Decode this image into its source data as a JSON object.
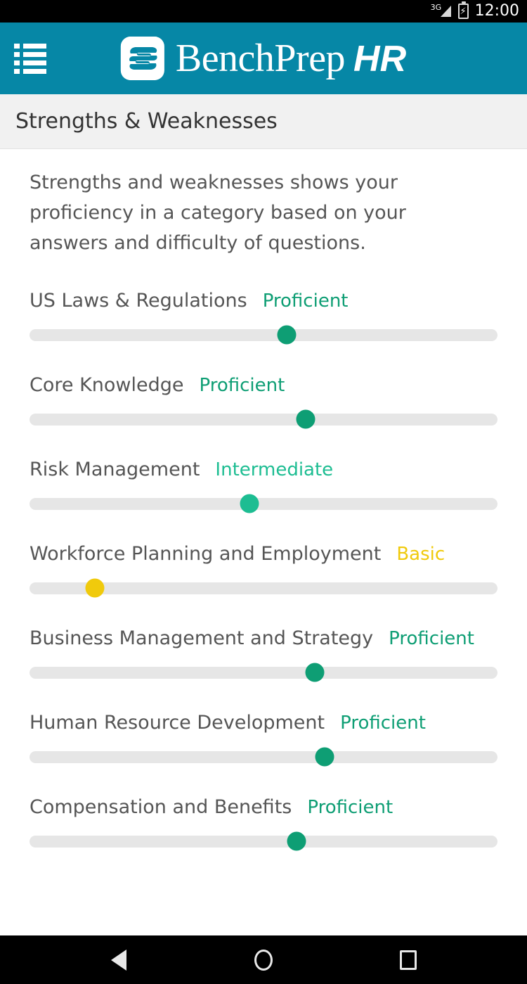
{
  "status_bar": {
    "network_label": "3G",
    "signal_icon": "signal-bars-icon",
    "battery_icon": "battery-charging-icon",
    "battery_glyph": "⚡",
    "time": "12:00"
  },
  "header": {
    "menu_icon": "list-menu-icon",
    "logo_icon": "benchprep-logo-icon",
    "brand_name": "BenchPrep",
    "brand_suffix": "HR",
    "background_color": "#0687a6"
  },
  "page": {
    "title": "Strengths & Weaknesses",
    "intro": "Strengths and weaknesses shows your proficiency in a category based on your answers and difficulty of questions."
  },
  "levels": {
    "proficient_color": "#14a07a",
    "intermediate_color": "#3dbe9b",
    "basic_color": "#e8b80a",
    "track_color": "#e6e6e6"
  },
  "skills": [
    {
      "name": "US Laws & Regulations",
      "level": "Proficient",
      "percent": 55,
      "color": "#0e9e74"
    },
    {
      "name": "Core Knowledge",
      "level": "Proficient",
      "percent": 59,
      "color": "#0e9e74"
    },
    {
      "name": "Risk Management",
      "level": "Intermediate",
      "percent": 47,
      "color": "#1dbd92"
    },
    {
      "name": "Workforce Planning and Employment",
      "level": "Basic",
      "percent": 14,
      "color": "#f0ca0c"
    },
    {
      "name": "Business Management and Strategy",
      "level": "Proficient",
      "percent": 61,
      "color": "#0e9e74"
    },
    {
      "name": "Human Resource Development",
      "level": "Proficient",
      "percent": 63,
      "color": "#0e9e74"
    },
    {
      "name": "Compensation and Benefits",
      "level": "Proficient",
      "percent": 57,
      "color": "#0e9e74"
    }
  ],
  "nav_bar": {
    "back_icon": "back-triangle-icon",
    "home_icon": "home-circle-icon",
    "recents_icon": "recents-square-icon"
  }
}
